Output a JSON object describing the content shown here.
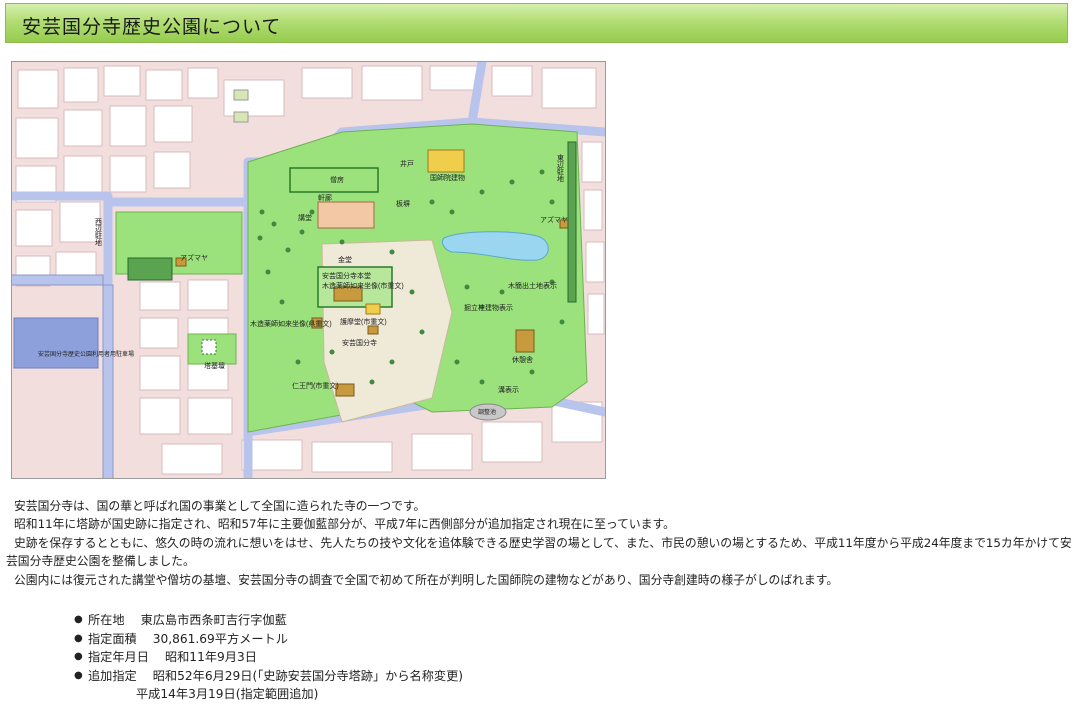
{
  "page": {
    "title": "安芸国分寺歴史公園について"
  },
  "map": {
    "labels": {
      "sobo": "僧房",
      "ido": "井戸",
      "kokushiin": "国師院建物",
      "nokiro": "軒廊",
      "itabei": "板塀",
      "kodo": "講堂",
      "kondo": "金堂",
      "higashi_parking": "東辺駐地",
      "nishi_parking": "西辺駐地",
      "azumaya1": "アズマヤ",
      "azumaya2": "アズマヤ",
      "hondo": "安芸国分寺本堂",
      "yakushi": "木造薬師如来坐像(市重文)",
      "mokkan": "木簡出土地表示",
      "hottate": "掘立柱建物表示",
      "kyukeijo": "休憩舎",
      "amida": "木造薬師如来坐像(県重文)",
      "gomado": "護摩堂(市重文)",
      "sekihi": "安芸国分寺",
      "tobato": "塔基壇",
      "niomon": "仁王門(市重文)",
      "mizohyoji": "溝表示",
      "chosuichi": "調整池",
      "chusha": "安芸国分寺歴史公園利用者用駐車場"
    }
  },
  "intro": [
    "安芸国分寺は、国の華と呼ばれ国の事業として全国に造られた寺の一つです。",
    "昭和11年に塔跡が国史跡に指定され、昭和57年に主要伽藍部分が、平成7年に西側部分が追加指定され現在に至っています。",
    "史跡を保存するとともに、悠久の時の流れに想いをはせ、先人たちの技や文化を追体験できる歴史学習の場として、また、市民の憩いの場とするため、平成11年度から平成24年度まで15カ年かけて安芸国分寺歴史公園を整備しました。",
    "公園内には復元された講堂や僧坊の基壇、安芸国分寺の調査で全国で初めて所在が判明した国師院の建物などがあり、国分寺創建時の様子がしのばれます。"
  ],
  "facts": {
    "bullet": "●",
    "location_label": "所在地",
    "location_value": "東広島市西条町吉行字伽藍",
    "area_label": "指定面積",
    "area_value": "30,861.69平方メートル",
    "date_label": "指定年月日",
    "date_value": "昭和11年9月3日",
    "add_label": "追加指定",
    "add_value_1": "昭和52年6月29日(「史跡安芸国分寺塔跡」から名称変更)",
    "add_value_2": "平成14年3月19日(指定範囲追加)"
  }
}
